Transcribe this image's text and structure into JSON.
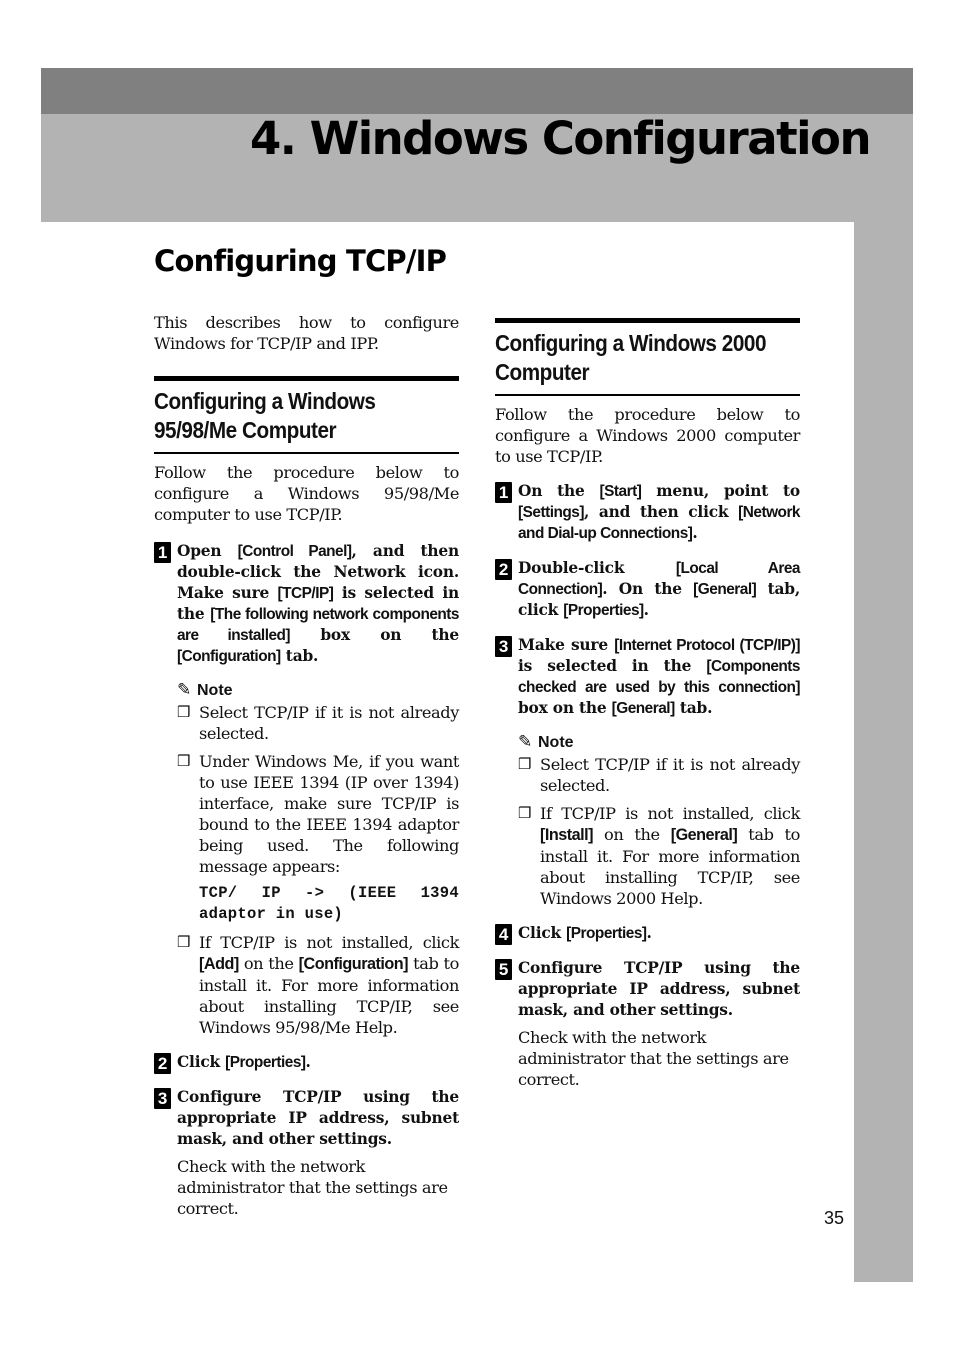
{
  "header": {
    "chapter_title": "4. Windows Configuration",
    "colors": {
      "dark_band": "#808080",
      "light_band": "#b3b3b3"
    }
  },
  "section": {
    "title": "Configuring TCP/IP",
    "intro": "This describes how to configure Windows for TCP/IP and IPP."
  },
  "win9x": {
    "heading": [
      "Configuring a Windows",
      "95/98/Me Computer"
    ],
    "intro": "Follow the procedure below to configure a Windows 95/98/Me computer to use TCP/IP.",
    "step1": {
      "num": "1",
      "t1": "Open ",
      "ui1": "[Control Panel]",
      "t2": ", and then double-click the Network icon. Make sure ",
      "ui2": "[TCP/IP]",
      "t3": " is selected in the ",
      "ui3": "[The following network components are installed]",
      "t4": " box on the ",
      "ui4": "[Configuration]",
      "t5": " tab."
    },
    "note": {
      "label": "Note",
      "item1": "Select TCP/IP if it is not already selected.",
      "item2": "Under Windows Me, if you want to use IEEE 1394 (IP over 1394) interface, make sure TCP/IP is bound to the IEEE 1394 adaptor being used. The following message appears:",
      "code": "TCP/ IP -> (IEEE 1394 adaptor in use)",
      "item3": {
        "t1": "If TCP/IP is not installed, click ",
        "ui1": "[Add]",
        "t2": " on the ",
        "ui2": "[Configuration]",
        "t3": " tab to install it. For more information about installing TCP/IP, see Windows 95/98/Me Help."
      }
    },
    "step2": {
      "num": "2",
      "t1": "Click ",
      "ui1": "[Properties]",
      "t2": "."
    },
    "step3": {
      "num": "3",
      "text": "Configure TCP/IP using the appropriate IP address, subnet mask, and other settings."
    },
    "check": "Check with the network administrator that the settings are correct."
  },
  "win2000": {
    "heading": [
      "Configuring a Windows 2000",
      "Computer"
    ],
    "intro": "Follow the procedure below to configure a Windows 2000 computer to use TCP/IP.",
    "step1": {
      "num": "1",
      "t1": "On the ",
      "ui1": "[Start]",
      "t2": " menu, point to ",
      "ui2": "[Settings]",
      "t3": ", and then click ",
      "ui3": "[Network and Dial-up Connections]",
      "t4": "."
    },
    "step2": {
      "num": "2",
      "t1": "Double-click ",
      "ui1": "[Local Area Connection]",
      "t2": ". On the ",
      "ui2": "[General]",
      "t3": " tab, click ",
      "ui3": "[Properties]",
      "t4": "."
    },
    "step3": {
      "num": "3",
      "t1": "Make sure ",
      "ui1": "[Internet Protocol (TCP/IP)]",
      "t2": " is selected in the ",
      "ui2": "[Components checked are used by this connection]",
      "t3": " box on the ",
      "ui3": "[General]",
      "t4": " tab."
    },
    "note": {
      "label": "Note",
      "item1": "Select TCP/IP if it is not already selected.",
      "item2": {
        "t1": "If TCP/IP is not installed, click ",
        "ui1": "[Install]",
        "t2": " on the ",
        "ui2": "[General]",
        "t3": " tab to install it. For more information about installing TCP/IP, see Windows 2000 Help."
      }
    },
    "step4": {
      "num": "4",
      "t1": "Click ",
      "ui1": "[Properties]",
      "t2": "."
    },
    "step5": {
      "num": "5",
      "text": "Configure TCP/IP using the appropriate IP address, subnet mask, and other settings."
    },
    "check": "Check with the network administrator that the settings are correct."
  },
  "footer": {
    "page_number": "35"
  }
}
